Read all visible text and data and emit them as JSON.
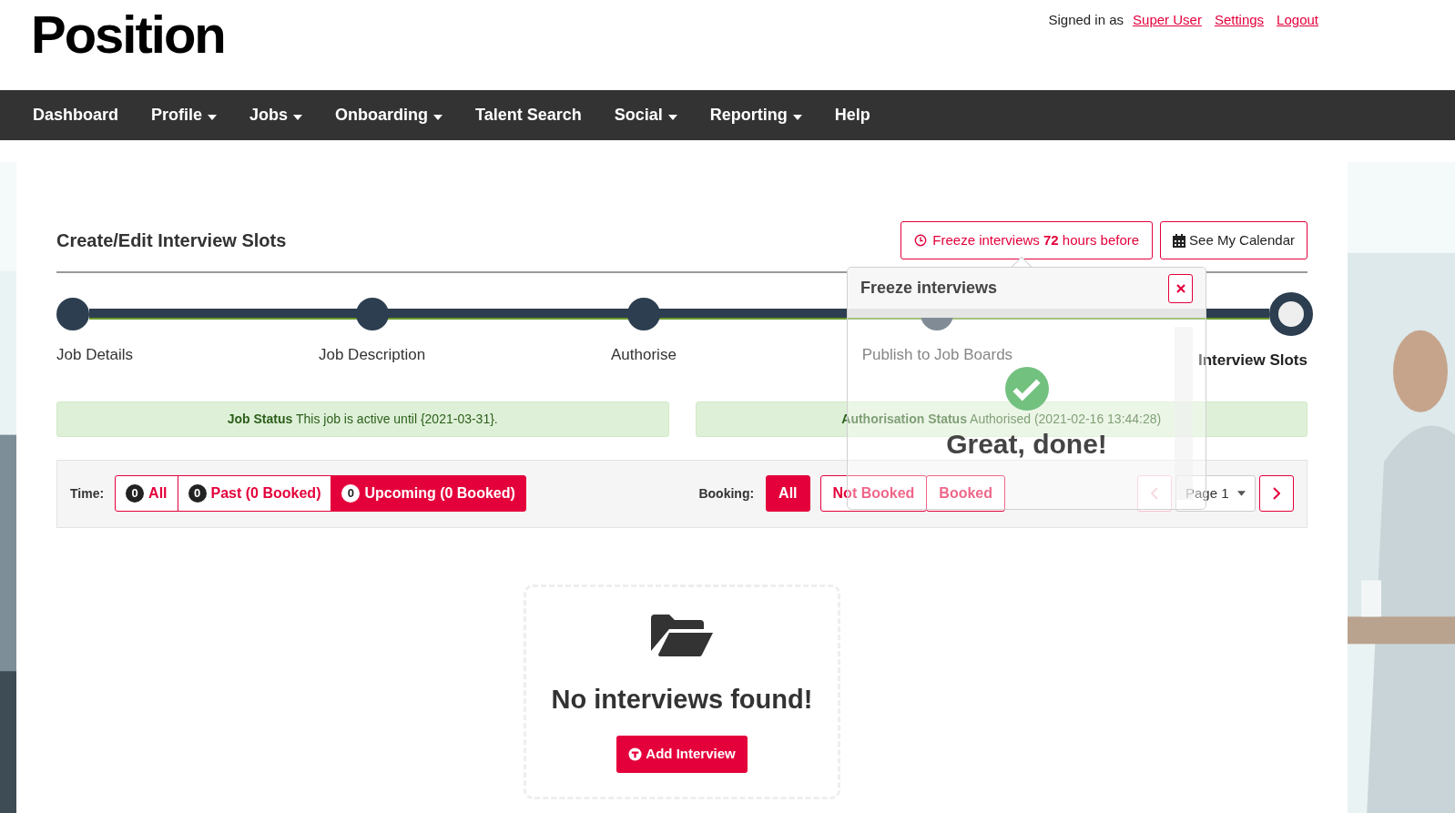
{
  "header": {
    "logo": "Position",
    "signed_in_label": "Signed in as",
    "links": [
      "Super User",
      "Settings",
      "Logout"
    ]
  },
  "nav": [
    {
      "label": "Dashboard",
      "dropdown": false
    },
    {
      "label": "Profile",
      "dropdown": true
    },
    {
      "label": "Jobs",
      "dropdown": true
    },
    {
      "label": "Onboarding",
      "dropdown": true
    },
    {
      "label": "Talent Search",
      "dropdown": false
    },
    {
      "label": "Social",
      "dropdown": true
    },
    {
      "label": "Reporting",
      "dropdown": true
    },
    {
      "label": "Help",
      "dropdown": false
    }
  ],
  "page": {
    "title": "Create/Edit Interview Slots",
    "freeze_button": "Freeze interviews **72** hours before",
    "calendar_button": "See My Calendar"
  },
  "steps": [
    {
      "label": "Job Details",
      "selected": false
    },
    {
      "label": "Job Description",
      "selected": false
    },
    {
      "label": "Authorise",
      "selected": false
    },
    {
      "label": "Publish to Job Boards",
      "selected": false
    },
    {
      "label": "Interview Slots",
      "selected": true
    }
  ],
  "status": [
    "**Job Status** This job is active until {2021-03-31}.",
    "**Authorisation Status** Authorised (2021-02-16 13:44:28)"
  ],
  "filters": {
    "time_label": "Time:",
    "time_options": [
      {
        "count": "0",
        "label": "All",
        "selected": false
      },
      {
        "count": "0",
        "label": "Past (0 Booked)",
        "selected": false
      },
      {
        "count": "0",
        "label": "Upcoming (0 Booked)",
        "selected": true
      }
    ],
    "booking_label": "Booking:",
    "booking_options": [
      {
        "label": "All",
        "selected": true
      },
      {
        "label": "Not Booked",
        "selected": false
      },
      {
        "label": "Booked",
        "selected": false
      }
    ],
    "pager": {
      "page": "Page 1",
      "prev_disabled": true
    }
  },
  "empty": {
    "message": "No interviews found!",
    "button": "Add Interview"
  },
  "popup": {
    "title": "Freeze interviews",
    "message": "Great, done!"
  }
}
